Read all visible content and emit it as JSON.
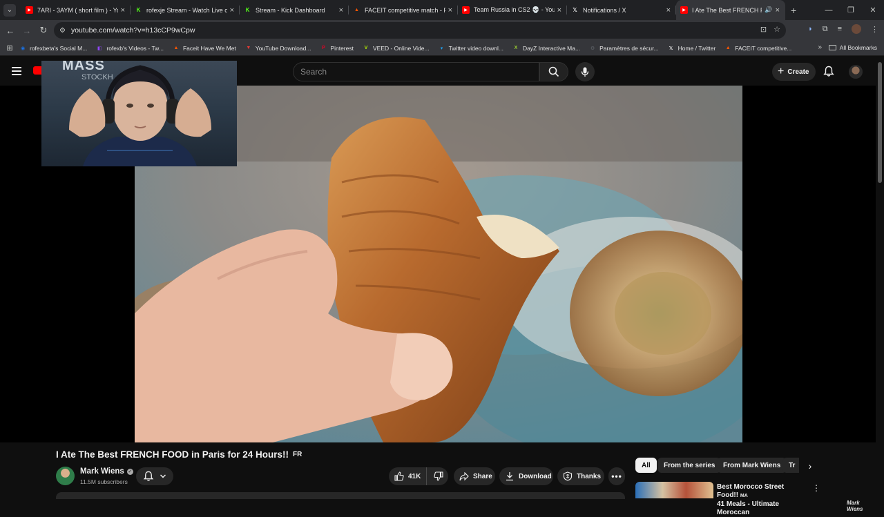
{
  "browser": {
    "tabs": [
      {
        "title": "7ARI - 3AYM ( short film ) - YouTube",
        "favicon": "youtube-icon",
        "color": "#ff0000",
        "active": false
      },
      {
        "title": "rofexje Stream - Watch Live on Kick",
        "favicon": "kick-icon",
        "color": "#53fc18",
        "active": false
      },
      {
        "title": "Stream - Kick Dashboard",
        "favicon": "kick-icon",
        "color": "#53fc18",
        "active": false
      },
      {
        "title": "FACEIT competitive match - FACEIT",
        "favicon": "faceit-icon",
        "color": "#ff5500",
        "active": false
      },
      {
        "title": "Team Russia in CS2 💀 - YouTube",
        "favicon": "youtube-icon",
        "color": "#ff0000",
        "active": false
      },
      {
        "title": "Notifications / X",
        "favicon": "x-icon",
        "color": "#ffffff",
        "active": false
      },
      {
        "title": "I Ate The Best FRENCH FOOD",
        "favicon": "youtube-icon",
        "color": "#ff0000",
        "active": true,
        "audio": true
      }
    ],
    "url": "youtube.com/watch?v=h13cCP9wCpw",
    "bookmarks": [
      {
        "label": "rofexbeta's Social M...",
        "icon": "social-icon",
        "color": "#1a73e8"
      },
      {
        "label": "rofexb's Videos - Tw...",
        "icon": "twitch-icon",
        "color": "#9146ff"
      },
      {
        "label": "Faceit Have We Met",
        "icon": "faceit-icon",
        "color": "#ff5500"
      },
      {
        "label": "YouTube Download...",
        "icon": "download-icon",
        "color": "#e53935"
      },
      {
        "label": "Pinterest",
        "icon": "pinterest-icon",
        "color": "#e60023"
      },
      {
        "label": "VEED - Online Vide...",
        "icon": "veed-icon",
        "color": "#b4f000"
      },
      {
        "label": "Twitter video downl...",
        "icon": "twitter-dl-icon",
        "color": "#1da1f2"
      },
      {
        "label": "DayZ Interactive Ma...",
        "icon": "x-letter-icon",
        "color": "#9acd32"
      },
      {
        "label": "Paramètres de sécur...",
        "icon": "settings-icon",
        "color": "#5f6368"
      },
      {
        "label": "Home / Twitter",
        "icon": "x-icon",
        "color": "#ffffff"
      },
      {
        "label": "FACEIT competitive...",
        "icon": "faceit-icon",
        "color": "#ff5500"
      }
    ],
    "all_bookmarks_label": "All Bookmarks"
  },
  "youtube": {
    "search_placeholder": "Search",
    "create_label": "Create",
    "webcam_sign": "MASS",
    "webcam_sign_sub": "STOCKH",
    "watermark_line1": "Mark",
    "watermark_line2": "Wiens",
    "video": {
      "title": "I Ate The Best FRENCH FOOD in Paris for 24 Hours!!",
      "title_badge": "FR",
      "channel": "Mark Wiens",
      "subscribers": "11.5M subscribers",
      "likes": "41K",
      "share_label": "Share",
      "download_label": "Download",
      "thanks_label": "Thanks"
    },
    "chips": [
      "All",
      "From the series",
      "From Mark Wiens",
      "Tr"
    ],
    "recommendation": {
      "title": "Best Morocco Street Food!!",
      "badge": "MA",
      "subtitle": "41 Meals - Ultimate Moroccan"
    }
  },
  "colors": {
    "accent": "#ff0000",
    "background": "#0f0f0f",
    "pill": "#272727"
  }
}
